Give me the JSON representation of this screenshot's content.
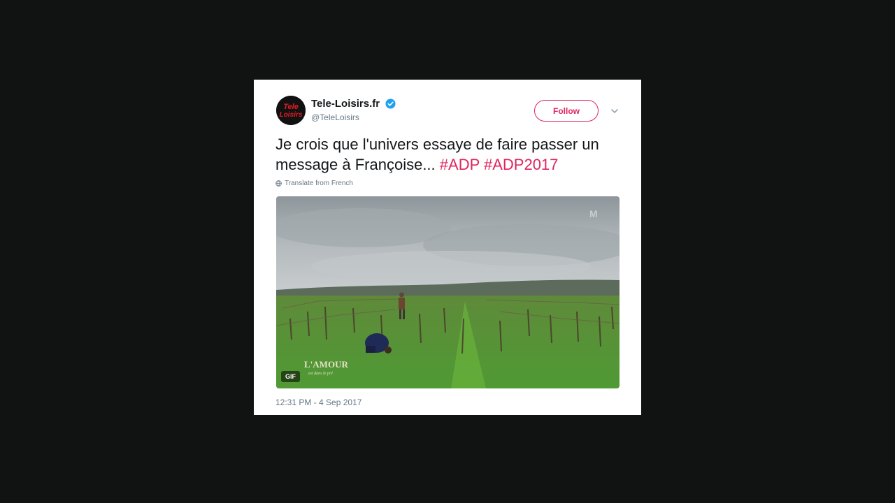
{
  "tweet": {
    "display_name": "Tele-Loisirs.fr",
    "handle": "@TeleLoisirs",
    "avatar_text": "Tele Loisirs",
    "follow_label": "Follow",
    "text_plain": "Je crois que l'univers essaye de faire passer un message à Françoise... ",
    "hashtags": [
      "#ADP",
      "#ADP2017"
    ],
    "translate_label": "Translate from French",
    "media_badge": "GIF",
    "media_watermark": "L'AMOUR est dans le pré",
    "timestamp": "12:31 PM - 4 Sep 2017"
  },
  "icons": {
    "verified": "verified-badge-icon",
    "chevron": "chevron-down-icon",
    "globe": "globe-icon"
  },
  "colors": {
    "accent": "#e0245e",
    "verified": "#1da1f2",
    "muted": "#657786",
    "text": "#14171a",
    "background": "#111312"
  }
}
